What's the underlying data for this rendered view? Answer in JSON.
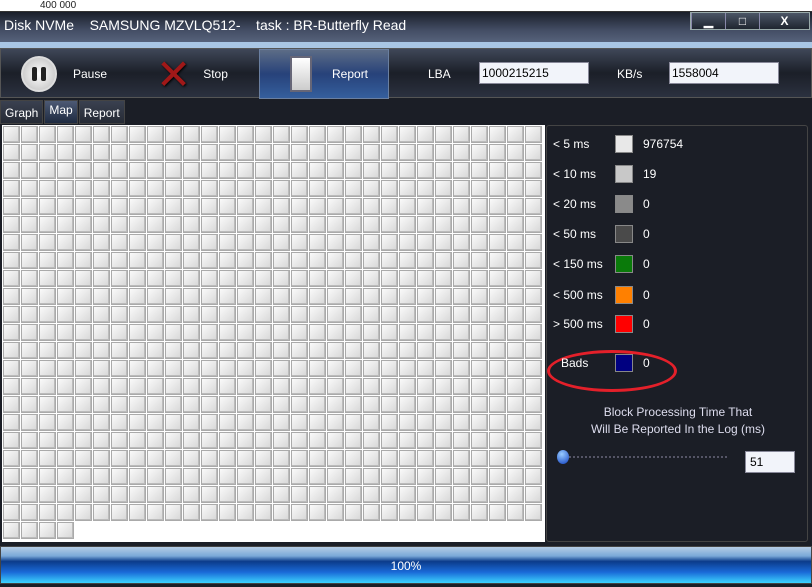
{
  "background_fragment": "400 000",
  "window": {
    "title": "Disk NVMe    SAMSUNG MZVLQ512-    task : BR-Butterfly Read",
    "buttons": [
      "▁",
      "□",
      "X"
    ]
  },
  "toolbar": {
    "pause": "Pause",
    "stop": "Stop",
    "report": "Report",
    "lba_label": "LBA",
    "lba_value": "1000215215",
    "kbs_label": "KB/s",
    "kbs_value": "1558004"
  },
  "tabs": [
    {
      "label": "Graph"
    },
    {
      "label": "Map",
      "active": true
    },
    {
      "label": "Report"
    }
  ],
  "map": {
    "blocks_shown": 664
  },
  "legend": [
    {
      "label": "< 5 ms",
      "color": "#e8e8e8",
      "count": "976754"
    },
    {
      "label": "< 10 ms",
      "color": "#c8c8c8",
      "count": "19"
    },
    {
      "label": "< 20 ms",
      "color": "#8a8a8a",
      "count": "0"
    },
    {
      "label": "< 50 ms",
      "color": "#4a4a4a",
      "count": "0"
    },
    {
      "label": "< 150 ms",
      "color": "#0a7a0a",
      "count": "0"
    },
    {
      "label": "< 500 ms",
      "color": "#ff8000",
      "count": "0"
    },
    {
      "label": "> 500 ms",
      "color": "#ff0000",
      "count": "0"
    },
    {
      "label": "Bads",
      "color": "#000080",
      "count": "0"
    }
  ],
  "threshold": {
    "line1": "Block Processing Time That",
    "line2": "Will Be Reported In the Log (ms)",
    "value": "51"
  },
  "progress": {
    "label": "100%",
    "value": 100
  }
}
